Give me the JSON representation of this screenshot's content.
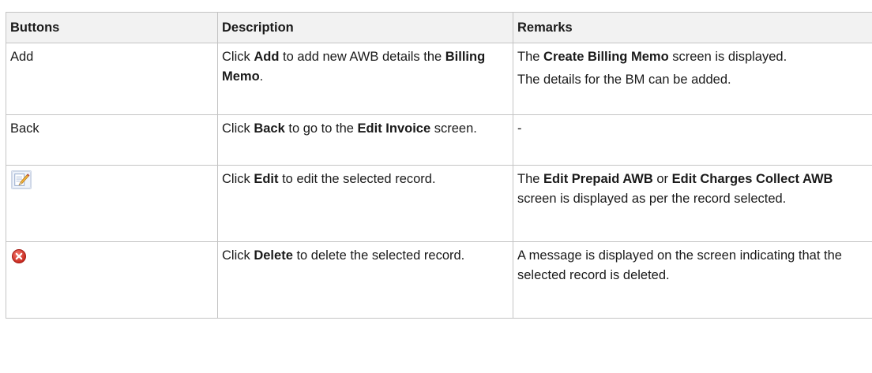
{
  "table": {
    "headers": [
      "Buttons",
      "Description",
      "Remarks"
    ],
    "rows": [
      {
        "button": "Add",
        "description": [
          "Click ",
          {
            "b": "Add"
          },
          " to add new AWB details the ",
          {
            "b": "Billing Memo"
          },
          "."
        ],
        "remarks": [
          [
            "The ",
            {
              "b": "Create Billing Memo"
            },
            " screen is displayed."
          ],
          [
            "The details for the BM can be added."
          ]
        ]
      },
      {
        "button": "Back",
        "description": [
          "Click ",
          {
            "b": "Back"
          },
          " to go to the ",
          {
            "b": "Edit Invoice"
          },
          " screen."
        ],
        "remarks": [
          [
            "-"
          ]
        ]
      },
      {
        "button_icon": "edit-icon",
        "description": [
          "Click ",
          {
            "b": "Edit"
          },
          " to edit the selected record."
        ],
        "remarks": [
          [
            "The ",
            {
              "b": "Edit Prepaid AWB"
            },
            " or ",
            {
              "b": "Edit Charges Collect AWB"
            },
            " screen is displayed as per the record selected."
          ]
        ]
      },
      {
        "button_icon": "delete-icon",
        "description": [
          "Click ",
          {
            "b": "Delete"
          },
          " to delete the selected record."
        ],
        "remarks": [
          [
            "A message is displayed on the screen indicating that the selected record is deleted."
          ]
        ]
      }
    ]
  },
  "colors": {
    "header_bg": "#f2f2f2",
    "border": "#c4c4c4",
    "delete_icon": "#d9342b"
  }
}
